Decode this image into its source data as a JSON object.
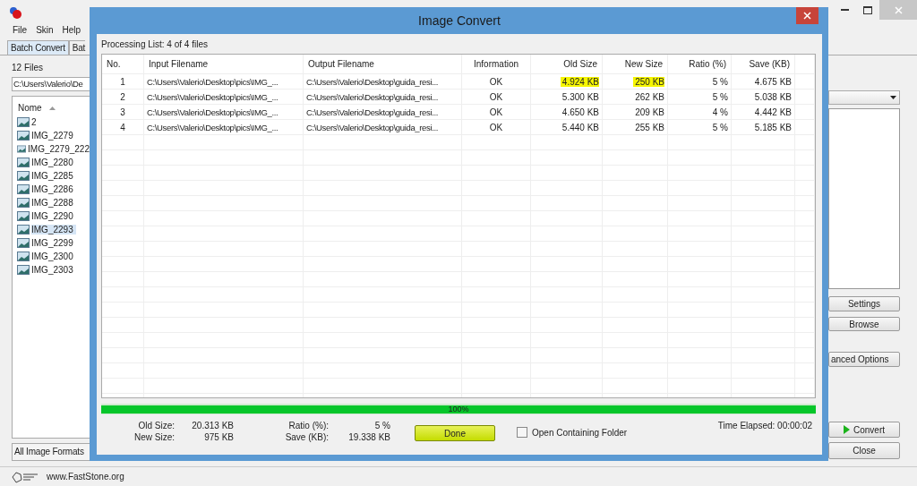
{
  "main_window": {
    "menu": [
      "File",
      "Skin",
      "Help"
    ],
    "tabs": [
      {
        "label": "Batch Convert",
        "selected": true
      },
      {
        "label": "Bat",
        "selected": false
      }
    ],
    "file_count": "12 Files",
    "path": "C:\\Users\\Valerio\\De",
    "file_list": {
      "header": "Nome",
      "items": [
        {
          "name": "2",
          "selected": false
        },
        {
          "name": "IMG_2279",
          "selected": false
        },
        {
          "name": "IMG_2279_222",
          "selected": false
        },
        {
          "name": "IMG_2280",
          "selected": false
        },
        {
          "name": "IMG_2285",
          "selected": false
        },
        {
          "name": "IMG_2286",
          "selected": false
        },
        {
          "name": "IMG_2288",
          "selected": false
        },
        {
          "name": "IMG_2290",
          "selected": false
        },
        {
          "name": "IMG_2293",
          "selected": true
        },
        {
          "name": "IMG_2299",
          "selected": false
        },
        {
          "name": "IMG_2300",
          "selected": false
        },
        {
          "name": "IMG_2303",
          "selected": false
        }
      ]
    },
    "format_filter": "All Image Formats",
    "right_buttons": [
      "Settings",
      "Browse",
      "anced Options"
    ],
    "convert_button": "Convert",
    "close_button": "Close",
    "status_bar": {
      "website": "www.FastStone.org"
    }
  },
  "dialog": {
    "title": "Image Convert",
    "list_label": "Processing List: 4 of 4 files",
    "table": {
      "columns": [
        "No.",
        "Input Filename",
        "Output Filename",
        "Information",
        "Old Size",
        "New Size",
        "Ratio (%)",
        "Save (KB)"
      ],
      "rows": [
        {
          "cells": [
            {
              "text": "1",
              "highlighted": false
            },
            {
              "text": "C:\\Users\\Valerio\\Desktop\\pics\\IMG_...",
              "highlighted": false
            },
            {
              "text": "C:\\Users\\Valerio\\Desktop\\guida_resi...",
              "highlighted": false
            },
            {
              "text": "OK",
              "highlighted": false
            },
            {
              "text": "4.924 KB",
              "highlighted": true
            },
            {
              "text": "250 KB",
              "highlighted": true
            },
            {
              "text": "5 %",
              "highlighted": false
            },
            {
              "text": "4.675 KB",
              "highlighted": false
            }
          ]
        },
        {
          "cells": [
            {
              "text": "2",
              "highlighted": false
            },
            {
              "text": "C:\\Users\\Valerio\\Desktop\\pics\\IMG_...",
              "highlighted": false
            },
            {
              "text": "C:\\Users\\Valerio\\Desktop\\guida_resi...",
              "highlighted": false
            },
            {
              "text": "OK",
              "highlighted": false
            },
            {
              "text": "5.300 KB",
              "highlighted": false
            },
            {
              "text": "262 KB",
              "highlighted": false
            },
            {
              "text": "5 %",
              "highlighted": false
            },
            {
              "text": "5.038 KB",
              "highlighted": false
            }
          ]
        },
        {
          "cells": [
            {
              "text": "3",
              "highlighted": false
            },
            {
              "text": "C:\\Users\\Valerio\\Desktop\\pics\\IMG_...",
              "highlighted": false
            },
            {
              "text": "C:\\Users\\Valerio\\Desktop\\guida_resi...",
              "highlighted": false
            },
            {
              "text": "OK",
              "highlighted": false
            },
            {
              "text": "4.650 KB",
              "highlighted": false
            },
            {
              "text": "209 KB",
              "highlighted": false
            },
            {
              "text": "4 %",
              "highlighted": false
            },
            {
              "text": "4.442 KB",
              "highlighted": false
            }
          ]
        },
        {
          "cells": [
            {
              "text": "4",
              "highlighted": false
            },
            {
              "text": "C:\\Users\\Valerio\\Desktop\\pics\\IMG_...",
              "highlighted": false
            },
            {
              "text": "C:\\Users\\Valerio\\Desktop\\guida_resi...",
              "highlighted": false
            },
            {
              "text": "OK",
              "highlighted": false
            },
            {
              "text": "5.440 KB",
              "highlighted": false
            },
            {
              "text": "255 KB",
              "highlighted": false
            },
            {
              "text": "5 %",
              "highlighted": false
            },
            {
              "text": "5.185 KB",
              "highlighted": false
            }
          ]
        }
      ]
    },
    "progress": {
      "level": 1,
      "label": "100%"
    },
    "summary": [
      {
        "label": "Old Size:",
        "value": "20.313 KB"
      },
      {
        "label": "Ratio (%):",
        "value": "5 %"
      },
      {
        "label": "New Size:",
        "value": "975 KB"
      },
      {
        "label": "Save (KB):",
        "value": "19.338 KB"
      }
    ],
    "done_button": "Done",
    "open_folder": {
      "label": "Open Containing Folder",
      "checked": false
    },
    "time_elapsed": "Time Elapsed: 00:00:02"
  }
}
